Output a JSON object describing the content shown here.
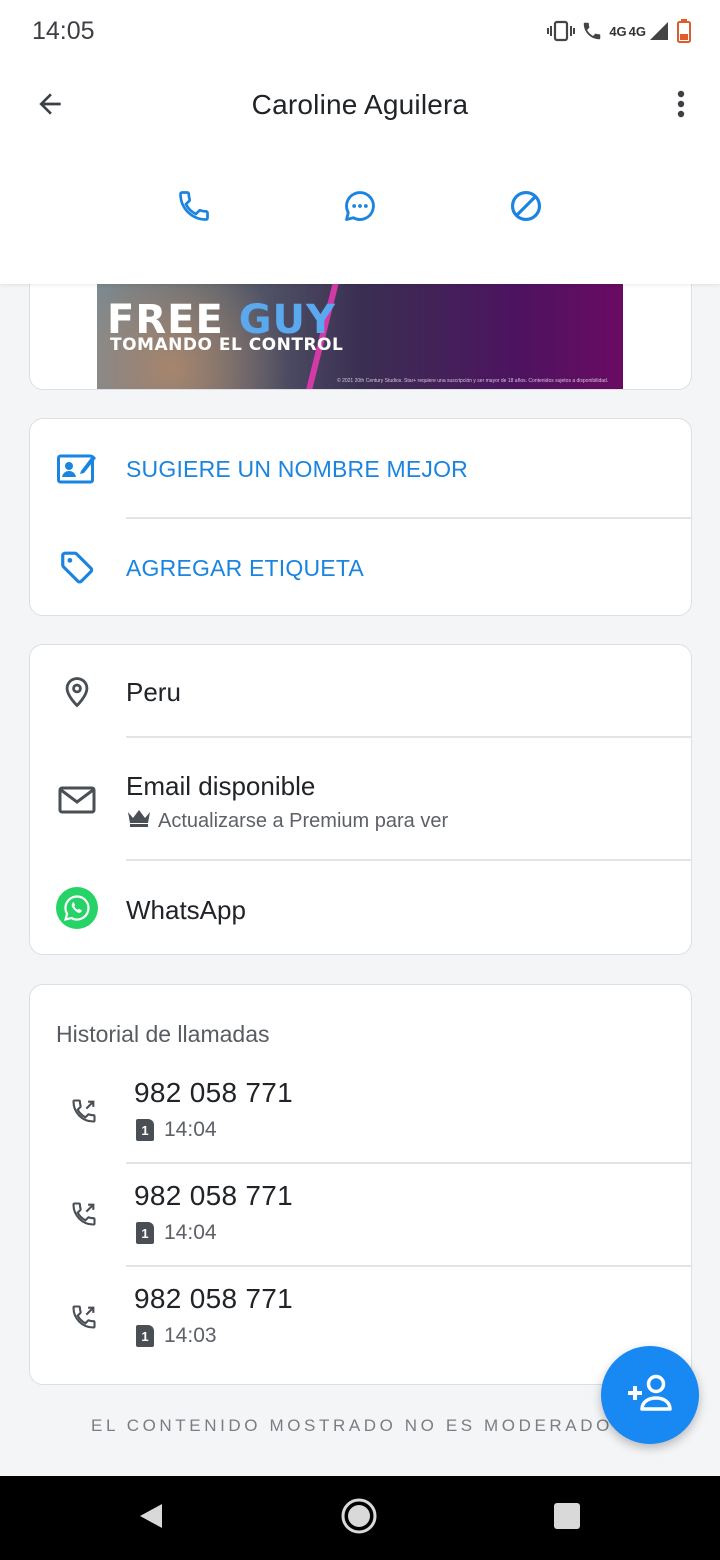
{
  "status_bar": {
    "time": "14:05",
    "network_tags": [
      "4G",
      "4G"
    ],
    "icons": [
      "vibrate-icon",
      "wifi-calling-icon",
      "signal-icon",
      "battery-low-icon"
    ]
  },
  "header": {
    "title": "Caroline Aguilera",
    "back_icon": "arrow-left-icon",
    "more_icon": "more-vert-icon",
    "actions": [
      {
        "name": "call",
        "icon": "phone-icon"
      },
      {
        "name": "message",
        "icon": "chat-bubble-icon"
      },
      {
        "name": "block",
        "icon": "block-icon"
      }
    ],
    "accent_color": "#1a84e0"
  },
  "ad": {
    "title_white": "FREE ",
    "title_blue": "GUY",
    "subtitle": "TOMANDO EL CONTROL",
    "fineprint": "© 2021 20th Century Studios. Star+ requiere una suscripción y ser mayor de 18 años. Contenidos sujetos a disponibilidad."
  },
  "suggest_card": {
    "items": [
      {
        "label": "SUGIERE UN NOMBRE MEJOR",
        "icon": "edit-contact-icon"
      },
      {
        "label": "AGREGAR ETIQUETA",
        "icon": "tag-icon"
      }
    ]
  },
  "info_card": {
    "location": {
      "label": "Peru",
      "icon": "location-pin-icon"
    },
    "email": {
      "label": "Email disponible",
      "sub": "Actualizarse a Premium para ver",
      "icon": "mail-icon",
      "sub_icon": "crown-icon"
    },
    "whatsapp": {
      "label": "WhatsApp",
      "icon": "whatsapp-icon",
      "color": "#25d366"
    }
  },
  "history": {
    "title": "Historial de llamadas",
    "calls": [
      {
        "number": "982 058 771",
        "sim": "1",
        "time": "14:04"
      },
      {
        "number": "982 058 771",
        "sim": "1",
        "time": "14:04"
      },
      {
        "number": "982 058 771",
        "sim": "1",
        "time": "14:03"
      }
    ]
  },
  "footer_note": "EL CONTENIDO MOSTRADO NO ES MODERADO",
  "fab": {
    "icon": "add-person-icon",
    "color": "#1888f2"
  },
  "nav_bar": {
    "icons": [
      "nav-back-icon",
      "nav-home-icon",
      "nav-recents-icon"
    ]
  }
}
